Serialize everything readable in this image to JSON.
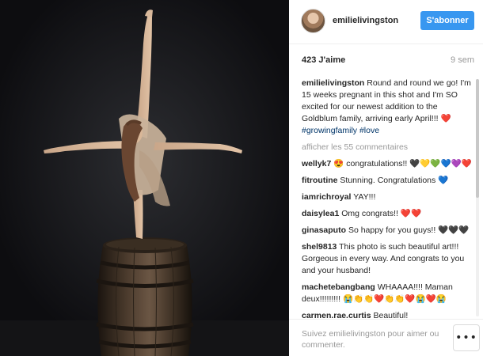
{
  "post": {
    "username": "emilielivingston",
    "follow_label": "S'abonner",
    "likes": "423 J'aime",
    "time_ago": "9 sem",
    "caption_user": "emilielivingston",
    "caption_text": "Round and round we go! I'm 15 weeks pregnant in this shot and I'm SO excited for our newest addition to the Goldblum family, arriving early April!!! ❤️ ",
    "hashtags": "#growingfamily #love",
    "view_more": "afficher les 55 commentaires"
  },
  "comments": [
    {
      "user": "wellyk7",
      "text": "😍 congratulations!! 🖤💛💚💙💜❤️"
    },
    {
      "user": "fitroutine",
      "text": "Stunning. Congratulations 💙"
    },
    {
      "user": "iamrichroyal",
      "text": "YAY!!!"
    },
    {
      "user": "daisylea1",
      "text": "Omg congrats!! ❤️❤️"
    },
    {
      "user": "ginasaputo",
      "text": "So happy for you guys!! 🖤🖤🖤"
    },
    {
      "user": "shel9813",
      "text": "This photo is such beautiful art!!! Gorgeous in every way. And congrats to you and your husband!"
    },
    {
      "user": "machetebangbang",
      "text": "WHAAAA!!!! Maman deux!!!!!!!!! 😭👏👏❤️👏👏❤️😭❤️😭"
    },
    {
      "user": "carmen.rae.curtis",
      "text": "Beautiful!"
    }
  ],
  "footer": {
    "login_prompt": "Suivez emilielivingston pour aimer ou commenter.",
    "options_label": "•••"
  },
  "icons": {
    "avatar": "profile-avatar",
    "options": "more-options-icon"
  },
  "colors": {
    "follow_button": "#3897f0",
    "hashtag": "#003569",
    "muted": "#999999"
  }
}
